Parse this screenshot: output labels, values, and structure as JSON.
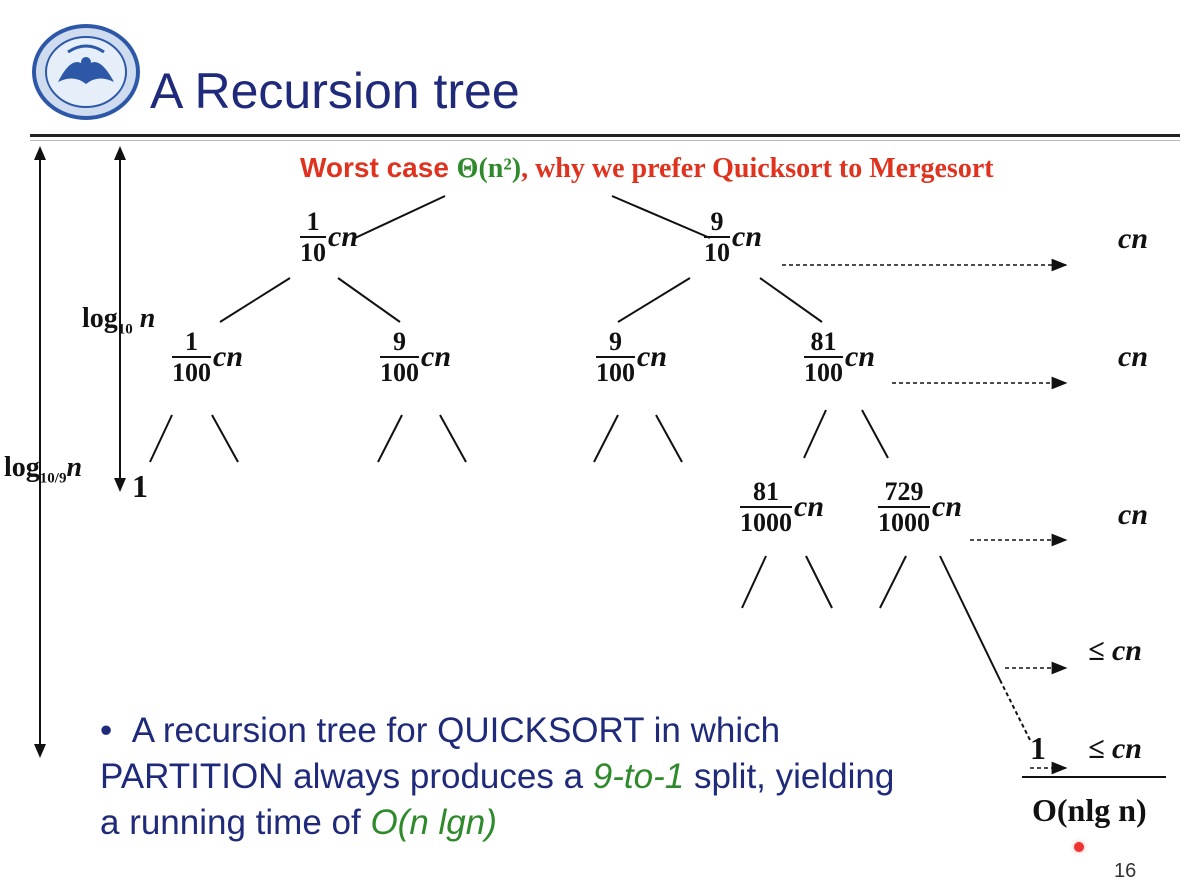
{
  "slide": {
    "title": "A Recursion tree",
    "page_number": "16"
  },
  "headline": {
    "part1": "Worst case ",
    "part2": "Θ(n²)",
    "part3": ", why we prefer Quicksort to Mergesort"
  },
  "tree": {
    "l1_left": {
      "num": "1",
      "den": "10",
      "cn": "cn"
    },
    "l1_right": {
      "num": "9",
      "den": "10",
      "cn": "cn"
    },
    "l2_a": {
      "num": "1",
      "den": "100",
      "cn": "cn"
    },
    "l2_b": {
      "num": "9",
      "den": "100",
      "cn": "cn"
    },
    "l2_c": {
      "num": "9",
      "den": "100",
      "cn": "cn"
    },
    "l2_d": {
      "num": "81",
      "den": "100",
      "cn": "cn"
    },
    "l3_a": {
      "num": "81",
      "den": "1000",
      "cn": "cn"
    },
    "l3_b": {
      "num": "729",
      "den": "1000",
      "cn": "cn"
    },
    "leaf_left": "1",
    "leaf_right": "1"
  },
  "level_costs": [
    "cn",
    "cn",
    "cn",
    "≤ cn",
    "≤ cn"
  ],
  "total": "O(nlg n)",
  "height_labels": {
    "short": {
      "base": "log",
      "sub": "10",
      "var": "n"
    },
    "long": {
      "base": "log",
      "sub": "10/9",
      "var": "n"
    }
  },
  "bullet": {
    "text1": "A recursion tree for QUICKSORT in which PARTITION always produces a ",
    "highlight1": "9-to-1",
    "text2": " split, yielding a running time of ",
    "highlight2": "O(n lgn)"
  },
  "colors": {
    "title_blue": "#1f2b7a",
    "headline_red": "#e0331f",
    "headline_green": "#2e8a2a",
    "laser_dot": "#e33"
  },
  "icons": [
    "university-seal-logo",
    "red-laser-pointer-dot"
  ]
}
